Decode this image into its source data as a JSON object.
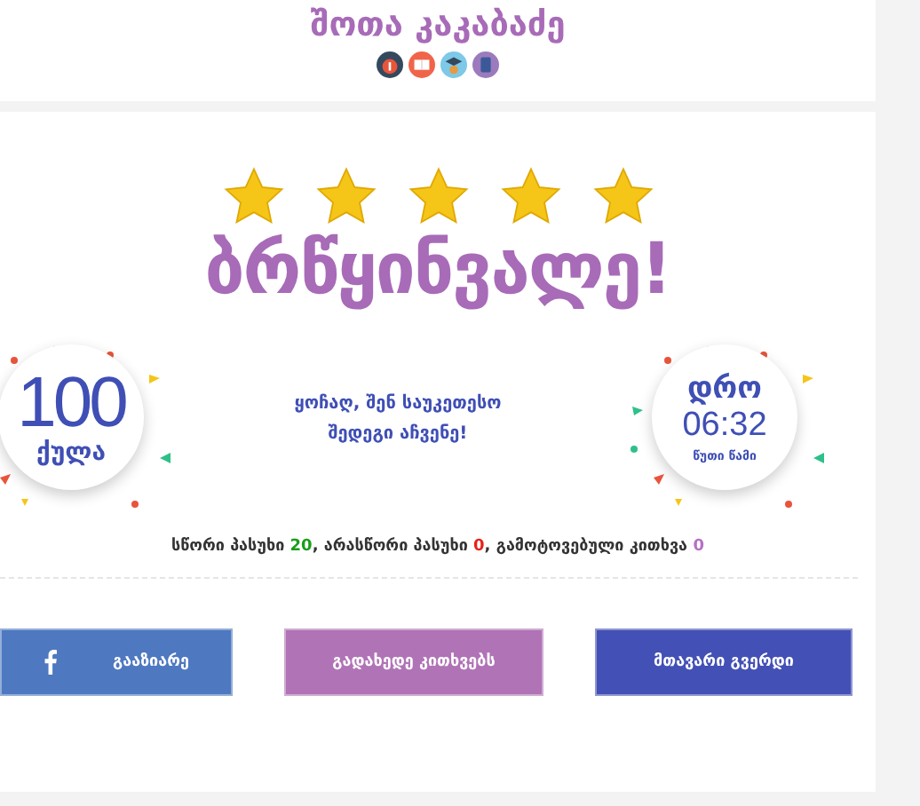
{
  "header": {
    "title": "შოთა კაკაბაძე"
  },
  "result": {
    "stars": 5,
    "headline": "ბრწყინვალე!"
  },
  "score": {
    "value": "100",
    "unit": "ქულა"
  },
  "message": "ყოჩაღ, შენ საუკეთესო შედეგი აჩვენე!",
  "time": {
    "label": "დრო",
    "value": "06:32",
    "unit": "წუთი წამი"
  },
  "stats": [
    {
      "label": "სწორი პასუხი",
      "value": "20",
      "color": "#1a9e1a"
    },
    {
      "label": ", არასწორი პასუხი",
      "value": "0",
      "color": "#e8211b"
    },
    {
      "label": ", გამოტოვებული კითხვა",
      "value": "0",
      "color": "#b472c4"
    }
  ],
  "buttons": [
    {
      "kind": "share",
      "label": "გააზიარე"
    },
    {
      "kind": "review",
      "label": "გადახედე კითხვებს"
    },
    {
      "kind": "home",
      "label": "მთავარი გვერდი"
    }
  ]
}
